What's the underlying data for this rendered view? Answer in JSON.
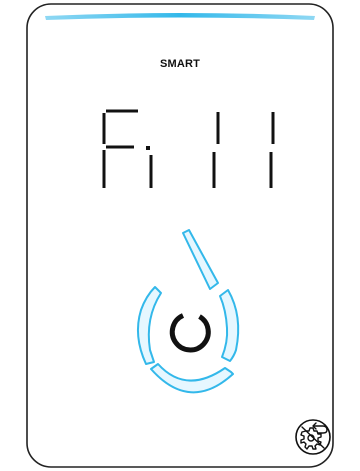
{
  "panel": {
    "mode_label": "SMART",
    "display_code": "F.11",
    "center_button_icon": "power-ring-icon",
    "corner_button_icon": "gear-cancel-icon"
  },
  "colors": {
    "accent": "#33b8ea",
    "accent_fill": "#e6f7ff",
    "glyph": "#111111",
    "frame": "#222222",
    "background": "#ffffff"
  }
}
